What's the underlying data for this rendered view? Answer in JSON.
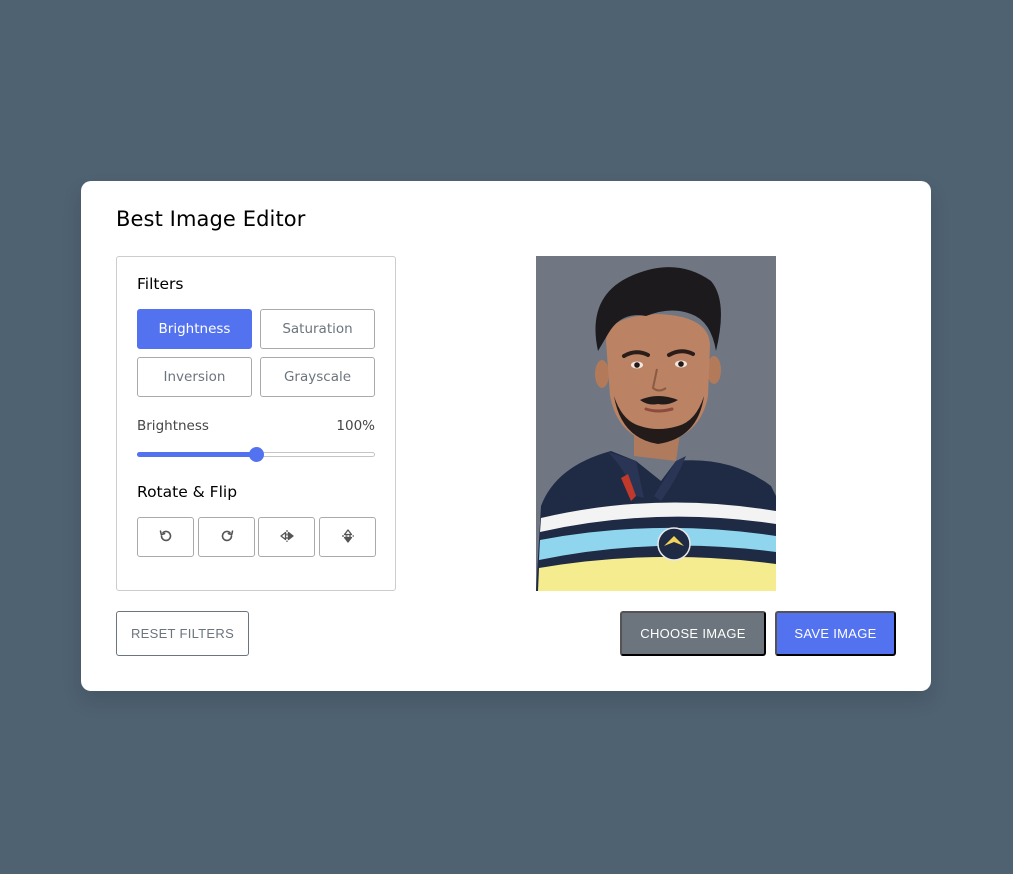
{
  "app": {
    "title": "Best Image Editor"
  },
  "filters": {
    "heading": "Filters",
    "options": [
      "Brightness",
      "Saturation",
      "Inversion",
      "Grayscale"
    ],
    "active": "Brightness"
  },
  "slider": {
    "name": "Brightness",
    "value_text": "100%",
    "level": 0.5
  },
  "rotate": {
    "heading": "Rotate & Flip",
    "buttons": [
      "rotate-left-icon",
      "rotate-right-icon",
      "flip-horizontal-icon",
      "flip-vertical-icon"
    ]
  },
  "actions": {
    "reset": "RESET FILTERS",
    "choose": "CHOOSE IMAGE",
    "save": "SAVE IMAGE"
  },
  "colors": {
    "background": "#4f6272",
    "accent": "#5372f0",
    "secondary": "#6c757d"
  }
}
